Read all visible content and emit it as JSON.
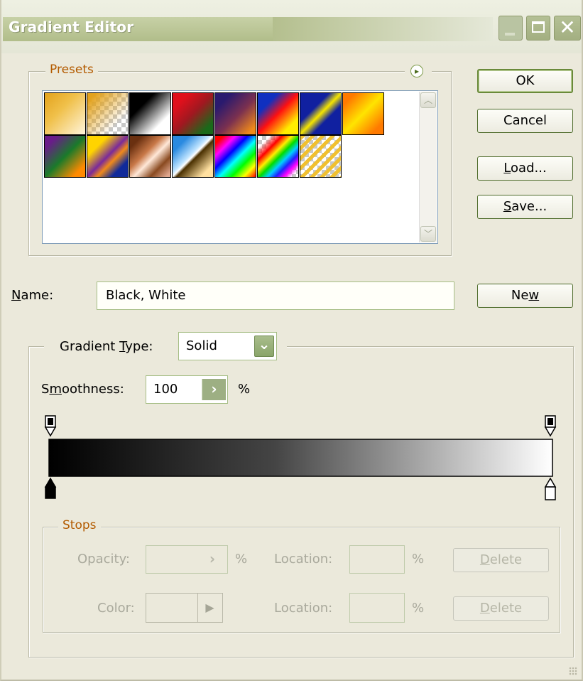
{
  "window": {
    "title": "Gradient Editor",
    "min_icon": "minimize-icon",
    "max_icon": "maximize-icon",
    "close_icon": "close-icon",
    "close_glyph": "✕"
  },
  "presets": {
    "label": "Presets",
    "menu_icon": "play-arrow-icon",
    "menu_glyph": "▸",
    "scroll_up_glyph": "︿",
    "scroll_down_glyph": "﹀",
    "swatches": [
      "orange-white",
      "orange-transparent",
      "black-white",
      "red-green",
      "violet-orange",
      "blue-red-yellow",
      "blue-yellow-blue",
      "orange-yellow-orange",
      "violet-green-orange",
      "yellow-violet-orange-blue",
      "copper",
      "chrome",
      "spectrum",
      "transparent-rainbow",
      "transparent-stripes"
    ]
  },
  "buttons": {
    "ok": "OK",
    "cancel": "Cancel",
    "load_u": "L",
    "load_rest": "oad...",
    "save_u": "S",
    "save_rest": "ave...",
    "new_pre": "Ne",
    "new_u": "w"
  },
  "name": {
    "label_u": "N",
    "label_rest": "ame:",
    "value": "Black, White"
  },
  "gradient_type": {
    "label_pre": "Gradient ",
    "label_u": "T",
    "label_rest": "ype:",
    "value": "Solid",
    "dropdown_icon": "chevron-down-icon",
    "dropdown_glyph": "⌄"
  },
  "smoothness": {
    "label_pre": "S",
    "label_u": "m",
    "label_rest": "oothness:",
    "value": "100",
    "unit": "%",
    "arrow_glyph": "›"
  },
  "gradient_bar": {
    "start_color": "#000000",
    "end_color": "#ffffff",
    "opacity_stops": [
      0,
      100
    ],
    "color_stops": [
      0,
      100
    ]
  },
  "stops": {
    "label": "Stops",
    "opacity_label": "Opacity:",
    "opacity_unit": "%",
    "opacity_arrow": "›",
    "location_label": "Location:",
    "location_unit": "%",
    "color_label": "Color:",
    "color_arrow": "▶",
    "location2_label": "Location:",
    "location2_unit": "%",
    "delete_u": "D",
    "delete_rest": "elete",
    "delete2_u": "D",
    "delete2_rest": "elete"
  }
}
